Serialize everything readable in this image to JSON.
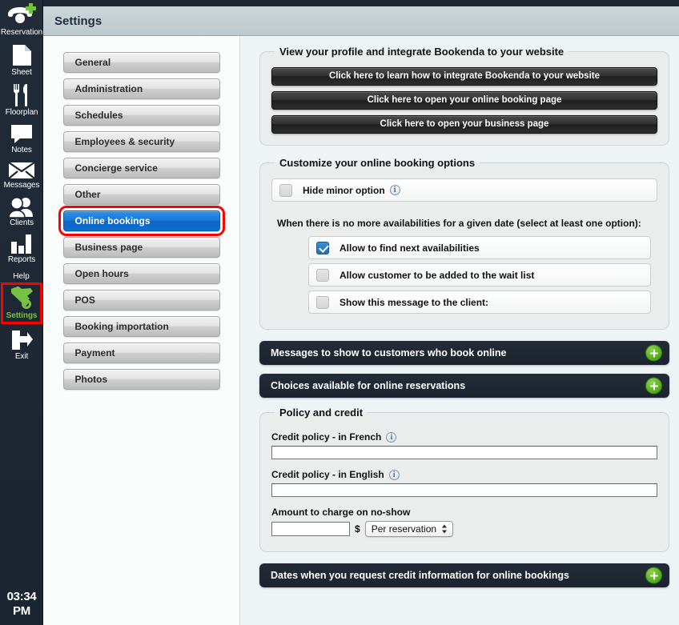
{
  "colors": {
    "accent_blue": "#1877d6",
    "highlight_red": "#ff0000",
    "green": "#5aaf21",
    "dark_bar": "#1f2733",
    "panel_bg": "#eef3f5"
  },
  "sidebar": {
    "items": [
      {
        "icon": "phone-plus-icon",
        "label": "Reservation"
      },
      {
        "icon": "sheet-page-icon",
        "label": "Sheet"
      },
      {
        "icon": "fork-knife-icon",
        "label": "Floorplan"
      },
      {
        "icon": "speech-bubble-icon",
        "label": "Notes"
      },
      {
        "icon": "envelope-icon",
        "label": "Messages"
      },
      {
        "icon": "people-icon",
        "label": "Clients"
      },
      {
        "icon": "bar-chart-icon",
        "label": "Reports"
      }
    ],
    "help_label": "Help",
    "settings": {
      "icon": "wrench-hammer-icon",
      "label": "Settings",
      "highlighted": true
    },
    "exit": {
      "icon": "exit-arrow-icon",
      "label": "Exit"
    },
    "clock": {
      "time": "03:34",
      "meridiem": "PM"
    }
  },
  "titlebar": {
    "title": "Settings"
  },
  "menu": {
    "items": [
      {
        "label": "General",
        "selected": false
      },
      {
        "label": "Administration",
        "selected": false
      },
      {
        "label": "Schedules",
        "selected": false
      },
      {
        "label": "Employees & security",
        "selected": false
      },
      {
        "label": "Concierge service",
        "selected": false
      },
      {
        "label": "Other",
        "selected": false
      },
      {
        "label": "Online bookings",
        "selected": true
      },
      {
        "label": "Business page",
        "selected": false
      },
      {
        "label": "Open hours",
        "selected": false
      },
      {
        "label": "POS",
        "selected": false
      },
      {
        "label": "Booking importation",
        "selected": false
      },
      {
        "label": "Payment",
        "selected": false
      },
      {
        "label": "Photos",
        "selected": false
      }
    ]
  },
  "profile_group": {
    "legend": "View your profile and integrate Bookenda to your website",
    "buttons": [
      "Click here to learn how to integrate Bookenda to your website",
      "Click here to open your online booking page",
      "Click here to open your business page"
    ]
  },
  "options_group": {
    "legend": "Customize your online booking options",
    "hide_minor": {
      "label": "Hide minor option",
      "checked": false,
      "info": "i"
    },
    "availability_note": "When there is no more availabilities for a given date (select at least one option):",
    "availability_options": [
      {
        "label": "Allow to find next availabilities",
        "checked": true
      },
      {
        "label": "Allow customer to be added to the wait list",
        "checked": false
      },
      {
        "label": "Show this message to the client:",
        "checked": false
      }
    ]
  },
  "bars": [
    {
      "label": "Messages to show to customers who book online",
      "action": "plus-icon"
    },
    {
      "label": "Choices available for online reservations",
      "action": "plus-icon"
    }
  ],
  "policy_group": {
    "legend": "Policy and credit",
    "credit_policy_french": {
      "label": "Credit policy - in French",
      "value": "",
      "info": "i"
    },
    "credit_policy_english": {
      "label": "Credit policy - in English",
      "value": "",
      "info": "i"
    },
    "amount": {
      "label": "Amount to charge on no-show",
      "value": "",
      "currency": "$",
      "unit_selected": "Per reservation"
    }
  },
  "bottom_bar": {
    "label": "Dates when you request credit information for online bookings",
    "action": "plus-icon"
  }
}
